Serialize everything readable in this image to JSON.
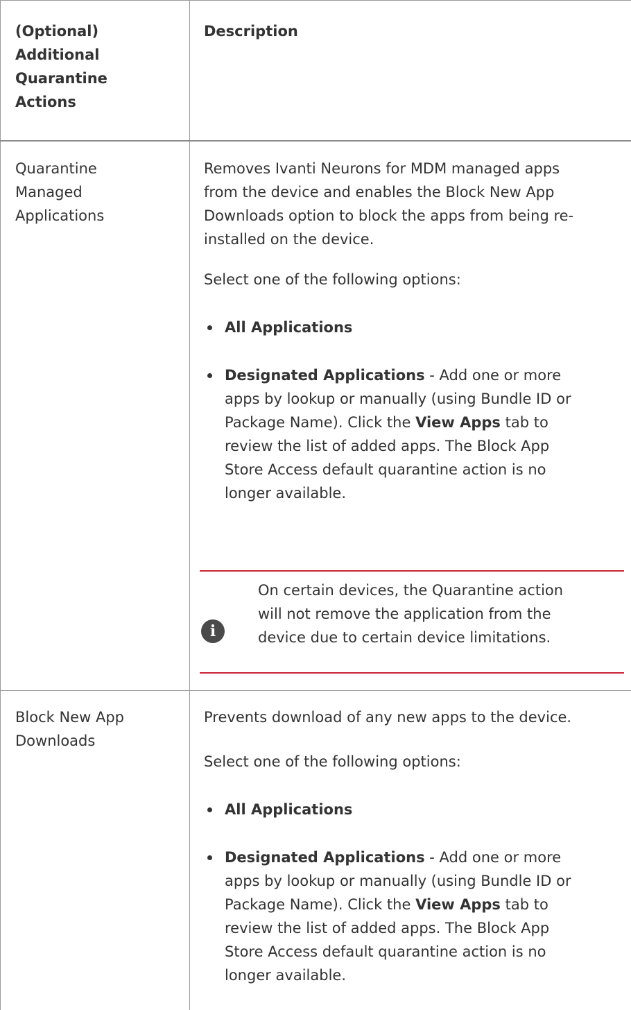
{
  "table": {
    "headers": {
      "col1": [
        "(Optional)",
        "Additional",
        "Quarantine",
        "Actions"
      ],
      "col2": "Description"
    },
    "rows": [
      {
        "action": [
          "Quarantine",
          "Managed",
          "Applications"
        ],
        "intro": [
          "Removes Ivanti Neurons for MDM managed apps",
          "from the device and enables the Block New App",
          "Downloads option to block the apps from being re-",
          "installed on the device."
        ],
        "select_text": "Select one of the following options:",
        "option1": "All Applications",
        "option2_bold": "Designated Applications",
        "option2_lines": [
          " - Add one or more",
          "apps by lookup or manually (using Bundle ID or",
          "Package Name). Click the ",
          " tab to",
          "review the list of added apps. The Block App",
          "Store Access default quarantine action is no",
          "longer available."
        ],
        "view_apps": "View Apps",
        "note_icon": "info-icon",
        "note_lines": [
          "On certain devices, the Quarantine action",
          "will not remove the application from the",
          "device due to certain device limitations."
        ]
      },
      {
        "action": [
          "Block New App",
          "Downloads"
        ],
        "intro": [
          "Prevents download of any new apps to the device."
        ],
        "select_text": "Select one of the following options:",
        "option1": "All Applications",
        "option2_bold": "Designated Applications",
        "option2_lines": [
          " - Add one or more",
          "apps by lookup or manually (using Bundle ID or",
          "Package Name). Click the ",
          " tab to",
          "review the list of added apps. The Block App",
          "Store Access default quarantine action is no",
          "longer available."
        ],
        "view_apps": "View Apps"
      }
    ]
  },
  "colors": {
    "note_rule": "#c9253a",
    "text": "#333333",
    "grid": "#9a9a9a"
  }
}
